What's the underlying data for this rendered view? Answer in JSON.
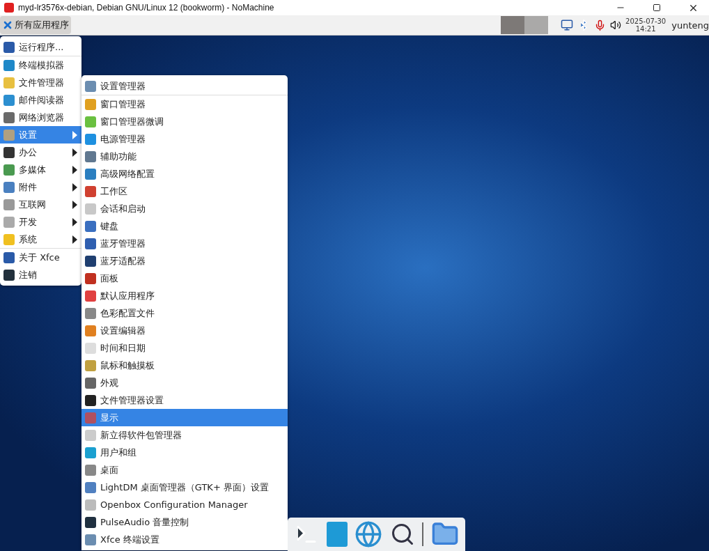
{
  "window": {
    "title": "myd-lr3576x-debian, Debian GNU/Linux 12 (bookworm) - NoMachine"
  },
  "panel": {
    "app_menu": "所有应用程序",
    "workspaces": [
      {
        "selected": true
      },
      {
        "selected": false
      }
    ],
    "clock": {
      "date": "2025-07-30",
      "time": "14:21"
    },
    "user": "yunteng"
  },
  "main_menu": [
    {
      "kind": "item",
      "label": "运行程序...",
      "selected": false,
      "submenu": false
    },
    {
      "kind": "separator"
    },
    {
      "kind": "item",
      "label": "终端模拟器",
      "selected": false,
      "submenu": false
    },
    {
      "kind": "item",
      "label": "文件管理器",
      "selected": false,
      "submenu": false
    },
    {
      "kind": "item",
      "label": "邮件阅读器",
      "selected": false,
      "submenu": false
    },
    {
      "kind": "item",
      "label": "网络浏览器",
      "selected": false,
      "submenu": false
    },
    {
      "kind": "item",
      "label": "设置",
      "selected": true,
      "submenu": true
    },
    {
      "kind": "item",
      "label": "办公",
      "selected": false,
      "submenu": true
    },
    {
      "kind": "item",
      "label": "多媒体",
      "selected": false,
      "submenu": true
    },
    {
      "kind": "item",
      "label": "附件",
      "selected": false,
      "submenu": true
    },
    {
      "kind": "item",
      "label": "互联网",
      "selected": false,
      "submenu": true
    },
    {
      "kind": "item",
      "label": "开发",
      "selected": false,
      "submenu": true
    },
    {
      "kind": "item",
      "label": "系统",
      "selected": false,
      "submenu": true
    },
    {
      "kind": "separator"
    },
    {
      "kind": "item",
      "label": "关于 Xfce",
      "selected": false,
      "submenu": false
    },
    {
      "kind": "item",
      "label": "注销",
      "selected": false,
      "submenu": false
    }
  ],
  "settings_menu": [
    {
      "kind": "item",
      "label": "设置管理器",
      "selected": false
    },
    {
      "kind": "separator"
    },
    {
      "kind": "item",
      "label": "窗口管理器",
      "selected": false
    },
    {
      "kind": "item",
      "label": "窗口管理器微调",
      "selected": false
    },
    {
      "kind": "item",
      "label": "电源管理器",
      "selected": false
    },
    {
      "kind": "item",
      "label": "辅助功能",
      "selected": false
    },
    {
      "kind": "item",
      "label": "高级网络配置",
      "selected": false
    },
    {
      "kind": "item",
      "label": "工作区",
      "selected": false
    },
    {
      "kind": "item",
      "label": "会话和启动",
      "selected": false
    },
    {
      "kind": "item",
      "label": "键盘",
      "selected": false
    },
    {
      "kind": "item",
      "label": "蓝牙管理器",
      "selected": false
    },
    {
      "kind": "item",
      "label": "蓝牙适配器",
      "selected": false
    },
    {
      "kind": "item",
      "label": "面板",
      "selected": false
    },
    {
      "kind": "item",
      "label": "默认应用程序",
      "selected": false
    },
    {
      "kind": "item",
      "label": "色彩配置文件",
      "selected": false
    },
    {
      "kind": "item",
      "label": "设置编辑器",
      "selected": false
    },
    {
      "kind": "item",
      "label": "时间和日期",
      "selected": false
    },
    {
      "kind": "item",
      "label": "鼠标和触摸板",
      "selected": false
    },
    {
      "kind": "item",
      "label": "外观",
      "selected": false
    },
    {
      "kind": "item",
      "label": "文件管理器设置",
      "selected": false
    },
    {
      "kind": "item",
      "label": "显示",
      "selected": true
    },
    {
      "kind": "item",
      "label": "新立得软件包管理器",
      "selected": false
    },
    {
      "kind": "item",
      "label": "用户和组",
      "selected": false
    },
    {
      "kind": "item",
      "label": "桌面",
      "selected": false
    },
    {
      "kind": "item",
      "label": "LightDM 桌面管理器（GTK+ 界面）设置",
      "selected": false
    },
    {
      "kind": "item",
      "label": "Openbox Configuration Manager",
      "selected": false
    },
    {
      "kind": "item",
      "label": "PulseAudio 音量控制",
      "selected": false
    },
    {
      "kind": "item",
      "label": "Xfce 终端设置",
      "selected": false
    }
  ]
}
